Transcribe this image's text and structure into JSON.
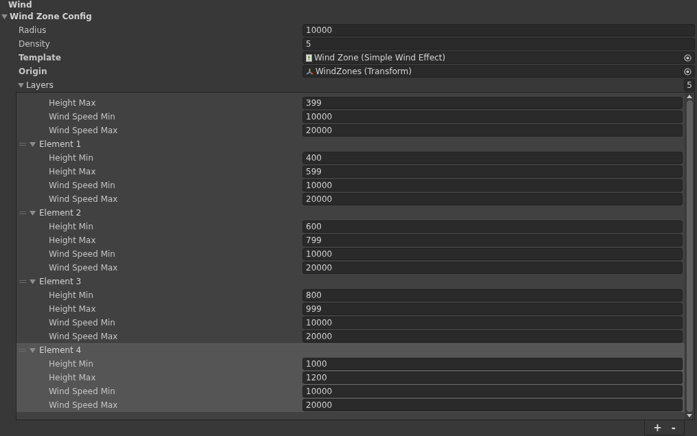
{
  "title": "Wind",
  "section": {
    "title": "Wind Zone Config",
    "expanded": true,
    "fields": [
      {
        "label": "Radius",
        "value": "10000",
        "kind": "number",
        "overridden": false
      },
      {
        "label": "Density",
        "value": "5",
        "kind": "number",
        "overridden": false
      },
      {
        "label": "Template",
        "value": "Wind Zone (Simple Wind Effect)",
        "kind": "asset",
        "overridden": true
      },
      {
        "label": "Origin",
        "value": "WindZones (Transform)",
        "kind": "transform",
        "overridden": true
      }
    ],
    "layers": {
      "label": "Layers",
      "expanded": true,
      "count": "5",
      "elements": [
        {
          "selected": false,
          "fields": [
            {
              "label": "Height Max",
              "value": "399"
            },
            {
              "label": "Wind Speed Min",
              "value": "10000"
            },
            {
              "label": "Wind Speed Max",
              "value": "20000"
            }
          ]
        },
        {
          "title": "Element 1",
          "selected": false,
          "expanded": true,
          "fields": [
            {
              "label": "Height Min",
              "value": "400"
            },
            {
              "label": "Height Max",
              "value": "599"
            },
            {
              "label": "Wind Speed Min",
              "value": "10000"
            },
            {
              "label": "Wind Speed Max",
              "value": "20000"
            }
          ]
        },
        {
          "title": "Element 2",
          "selected": false,
          "expanded": true,
          "fields": [
            {
              "label": "Height Min",
              "value": "600"
            },
            {
              "label": "Height Max",
              "value": "799"
            },
            {
              "label": "Wind Speed Min",
              "value": "10000"
            },
            {
              "label": "Wind Speed Max",
              "value": "20000"
            }
          ]
        },
        {
          "title": "Element 3",
          "selected": false,
          "expanded": true,
          "fields": [
            {
              "label": "Height Min",
              "value": "800"
            },
            {
              "label": "Height Max",
              "value": "999"
            },
            {
              "label": "Wind Speed Min",
              "value": "10000"
            },
            {
              "label": "Wind Speed Max",
              "value": "20000"
            }
          ]
        },
        {
          "title": "Element 4",
          "selected": true,
          "expanded": true,
          "fields": [
            {
              "label": "Height Min",
              "value": "1000"
            },
            {
              "label": "Height Max",
              "value": "1200"
            },
            {
              "label": "Wind Speed Min",
              "value": "10000"
            },
            {
              "label": "Wind Speed Max",
              "value": "20000"
            }
          ]
        }
      ],
      "buttons": [
        "+",
        "-"
      ]
    }
  }
}
